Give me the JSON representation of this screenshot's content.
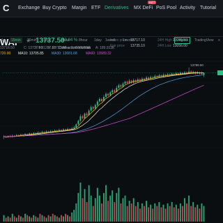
{
  "nav": {
    "logo": "C",
    "items": [
      {
        "label": "Exchange",
        "active": false
      },
      {
        "label": "Buy Crypto",
        "active": false
      },
      {
        "label": "Margin",
        "active": false
      },
      {
        "label": "ETF",
        "active": false
      },
      {
        "label": "Derivatives",
        "active": true
      },
      {
        "label": "MX DeFi",
        "active": false
      },
      {
        "label": "PoS Pool",
        "active": false
      },
      {
        "label": "Activity",
        "active": false
      },
      {
        "label": "Tutorial",
        "active": false
      }
    ],
    "badge": "HOT"
  },
  "header": {
    "pair": "WAP",
    "price": "13737.50",
    "change": "+0.94 %",
    "fiat": "≈ ¥ 91217.00",
    "contract_link": "Contract introduction",
    "index_label": "Index price",
    "index_value": "13717.10",
    "fair_label": "Fair price",
    "fair_value": "13735.10",
    "high_label": "24H High",
    "high_value": "13789.50",
    "low_label": "24H Low",
    "low_value": "13056.00"
  },
  "toolbar": {
    "timeframes": [
      {
        "label": "1m",
        "active": false
      },
      {
        "label": "15min",
        "active": true
      },
      {
        "label": "30min",
        "active": false
      },
      {
        "label": "1hour",
        "active": false
      },
      {
        "label": "4hour",
        "active": false
      },
      {
        "label": "8hour",
        "active": false
      },
      {
        "label": "1day",
        "active": false
      },
      {
        "label": "1week",
        "active": false
      },
      {
        "label": "1month",
        "active": false
      }
    ],
    "views": [
      {
        "label": "Original",
        "active": true
      },
      {
        "label": "TradingView",
        "active": false
      }
    ]
  },
  "ohlc": {
    "open": "13716.50",
    "close_label": "C: 13737.50",
    "high_label": "H: 13737.50",
    "low_label": "L: 13695.50",
    "amp_label": "A: 189.913K"
  },
  "ma": {
    "ma5_partial": "720.00",
    "ma10": "MA10: 13705.85",
    "ma30": "MA30: 13681.68",
    "ma60": "MA60: 13589.32"
  },
  "colors": {
    "up": "#2ebd85",
    "down": "#f6465d",
    "ma5": "#f0b90b",
    "ma10": "#e6e6e6",
    "ma30": "#4fa3e0",
    "ma60": "#d44fd4"
  },
  "chart_data": {
    "type": "candlestick",
    "title": "",
    "ylim": [
      13000,
      13850
    ],
    "annotation_high": "13789.50",
    "candles": [
      [
        13105,
        13110,
        13085,
        13125
      ],
      [
        13110,
        13102,
        13095,
        13120
      ],
      [
        13102,
        13115,
        13098,
        13122
      ],
      [
        13115,
        13108,
        13100,
        13128
      ],
      [
        13108,
        13118,
        13102,
        13130
      ],
      [
        13118,
        13112,
        13105,
        13126
      ],
      [
        13112,
        13125,
        13108,
        13135
      ],
      [
        13125,
        13118,
        13110,
        13132
      ],
      [
        13118,
        13130,
        13112,
        13140
      ],
      [
        13130,
        13122,
        13115,
        13138
      ],
      [
        13122,
        13135,
        13118,
        13145
      ],
      [
        13135,
        13128,
        13120,
        13140
      ],
      [
        13128,
        13140,
        13122,
        13150
      ],
      [
        13140,
        13132,
        13125,
        13148
      ],
      [
        13132,
        13145,
        13128,
        13155
      ],
      [
        13145,
        13138,
        13130,
        13152
      ],
      [
        13138,
        13150,
        13132,
        13162
      ],
      [
        13150,
        13142,
        13136,
        13158
      ],
      [
        13142,
        13155,
        13138,
        13165
      ],
      [
        13155,
        13148,
        13140,
        13162
      ],
      [
        13148,
        13160,
        13142,
        13172
      ],
      [
        13160,
        13152,
        13146,
        13168
      ],
      [
        13152,
        13165,
        13148,
        13175
      ],
      [
        13165,
        13158,
        13150,
        13172
      ],
      [
        13158,
        13170,
        13152,
        13182
      ],
      [
        13170,
        13162,
        13155,
        13178
      ],
      [
        13162,
        13175,
        13158,
        13188
      ],
      [
        13175,
        13168,
        13160,
        13182
      ],
      [
        13168,
        13180,
        13162,
        13192
      ],
      [
        13180,
        13172,
        13165,
        13188
      ],
      [
        13172,
        13185,
        13168,
        13198
      ],
      [
        13185,
        13178,
        13170,
        13192
      ],
      [
        13178,
        13190,
        13172,
        13205
      ],
      [
        13190,
        13200,
        13180,
        13215
      ],
      [
        13200,
        13230,
        13195,
        13240
      ],
      [
        13230,
        13265,
        13222,
        13275
      ],
      [
        13265,
        13310,
        13255,
        13330
      ],
      [
        13310,
        13290,
        13280,
        13325
      ],
      [
        13290,
        13335,
        13285,
        13345
      ],
      [
        13335,
        13320,
        13310,
        13350
      ],
      [
        13320,
        13365,
        13315,
        13380
      ],
      [
        13365,
        13400,
        13355,
        13415
      ],
      [
        13400,
        13385,
        13370,
        13412
      ],
      [
        13385,
        13420,
        13380,
        13435
      ],
      [
        13420,
        13455,
        13410,
        13470
      ],
      [
        13455,
        13480,
        13445,
        13495
      ],
      [
        13480,
        13460,
        13450,
        13490
      ],
      [
        13460,
        13500,
        13455,
        13520
      ],
      [
        13500,
        13530,
        13490,
        13545
      ],
      [
        13530,
        13515,
        13505,
        13540
      ],
      [
        13515,
        13545,
        13508,
        13560
      ],
      [
        13545,
        13565,
        13535,
        13580
      ],
      [
        13565,
        13550,
        13540,
        13578
      ],
      [
        13550,
        13590,
        13545,
        13610
      ],
      [
        13590,
        13615,
        13580,
        13630
      ],
      [
        13615,
        13600,
        13590,
        13625
      ],
      [
        13600,
        13630,
        13595,
        13645
      ],
      [
        13630,
        13650,
        13620,
        13660
      ],
      [
        13650,
        13635,
        13625,
        13662
      ],
      [
        13635,
        13660,
        13630,
        13675
      ],
      [
        13660,
        13640,
        13630,
        13668
      ],
      [
        13640,
        13665,
        13632,
        13680
      ],
      [
        13665,
        13650,
        13640,
        13675
      ],
      [
        13650,
        13672,
        13645,
        13690
      ],
      [
        13672,
        13660,
        13650,
        13685
      ],
      [
        13660,
        13680,
        13655,
        13695
      ],
      [
        13680,
        13670,
        13660,
        13690
      ],
      [
        13670,
        13690,
        13665,
        13705
      ],
      [
        13690,
        13678,
        13670,
        13700
      ],
      [
        13678,
        13695,
        13672,
        13710
      ],
      [
        13695,
        13688,
        13680,
        13705
      ],
      [
        13688,
        13705,
        13682,
        13720
      ],
      [
        13705,
        13695,
        13690,
        13715
      ],
      [
        13695,
        13712,
        13690,
        13725
      ],
      [
        13712,
        13700,
        13695,
        13720
      ],
      [
        13700,
        13718,
        13695,
        13730
      ],
      [
        13718,
        13708,
        13700,
        13726
      ],
      [
        13708,
        13722,
        13702,
        13735
      ],
      [
        13722,
        13712,
        13705,
        13730
      ],
      [
        13712,
        13728,
        13706,
        13740
      ],
      [
        13728,
        13715,
        13710,
        13735
      ],
      [
        13715,
        13732,
        13708,
        13745
      ],
      [
        13732,
        13720,
        13713,
        13740
      ],
      [
        13720,
        13738,
        13715,
        13750
      ],
      [
        13738,
        13725,
        13718,
        13745
      ],
      [
        13725,
        13742,
        13720,
        13755
      ],
      [
        13742,
        13730,
        13722,
        13750
      ],
      [
        13730,
        13750,
        13725,
        13789
      ],
      [
        13750,
        13735,
        13728,
        13760
      ],
      [
        13735,
        13745,
        13725,
        13758
      ],
      [
        13745,
        13730,
        13720,
        13752
      ],
      [
        13730,
        13740,
        13722,
        13755
      ],
      [
        13740,
        13728,
        13720,
        13750
      ],
      [
        13728,
        13738,
        13716,
        13750
      ],
      [
        13716,
        13737,
        13695,
        13737
      ]
    ],
    "volumes": [
      5,
      3,
      4,
      3,
      6,
      4,
      3,
      5,
      4,
      3,
      6,
      5,
      4,
      3,
      5,
      4,
      3,
      6,
      5,
      4,
      3,
      5,
      4,
      6,
      5,
      4,
      3,
      5,
      4,
      6,
      5,
      4,
      7,
      9,
      14,
      22,
      30,
      18,
      25,
      15,
      28,
      20,
      12,
      18,
      26,
      20,
      14,
      22,
      28,
      16,
      20,
      24,
      15,
      22,
      26,
      14,
      18,
      20,
      12,
      16,
      14,
      18,
      12,
      15,
      10,
      14,
      12,
      16,
      11,
      13,
      10,
      14,
      12,
      15,
      11,
      13,
      10,
      14,
      12,
      15,
      11,
      13,
      10,
      14,
      12,
      18,
      14,
      20,
      12,
      15,
      11,
      13,
      10,
      14,
      12
    ]
  }
}
